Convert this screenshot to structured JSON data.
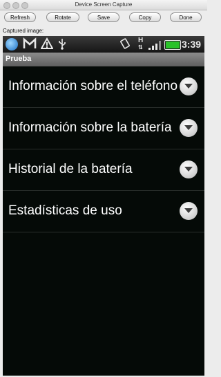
{
  "window": {
    "title": "Device Screen Capture"
  },
  "toolbar": {
    "refresh": "Refresh",
    "rotate": "Rotate",
    "save": "Save",
    "copy": "Copy",
    "done": "Done"
  },
  "captured_label": "Captured image:",
  "status": {
    "icons": [
      "app-icon",
      "gmail-icon",
      "warning-icon",
      "usb-icon",
      "vibrate-icon",
      "hspa-icon",
      "signal-icon",
      "battery-icon"
    ],
    "time": "3:39",
    "battery_color": "#29c229"
  },
  "appbar": {
    "title": "Prueba"
  },
  "rows": [
    {
      "label": "Información sobre el teléfono"
    },
    {
      "label": "Información sobre la batería"
    },
    {
      "label": "Historial de la batería"
    },
    {
      "label": "Estadísticas de uso"
    }
  ]
}
